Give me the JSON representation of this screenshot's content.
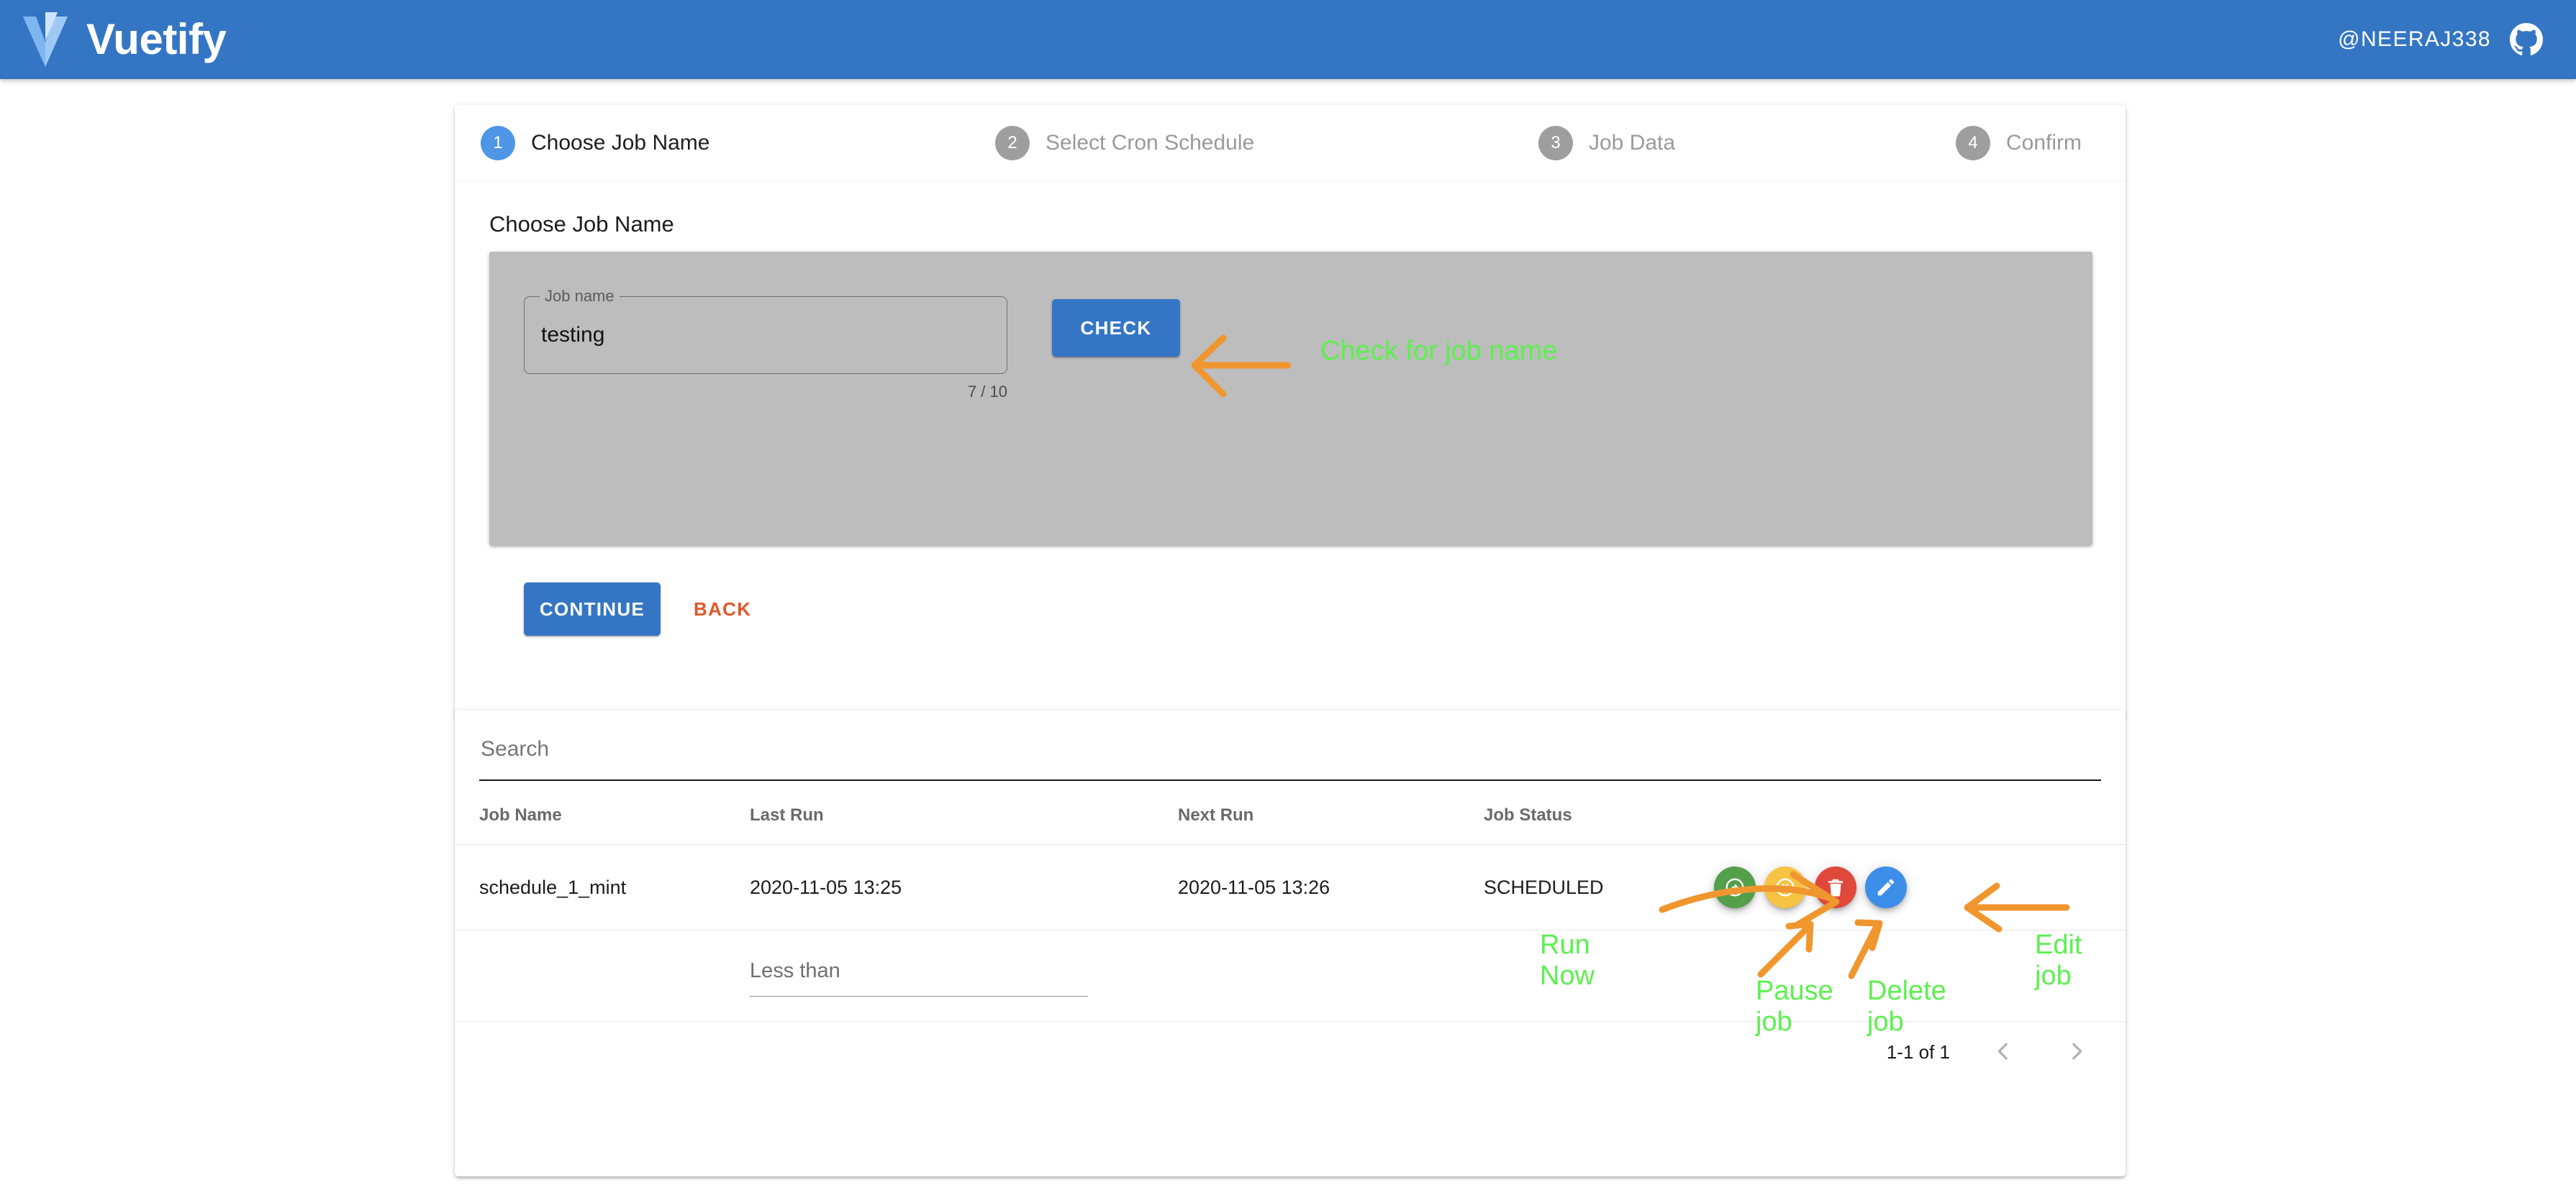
{
  "appbar": {
    "brand": "Vuetify",
    "handle": "@NEERAJ338",
    "github_icon": "github-icon",
    "bg_color": "#3476c4"
  },
  "stepper": {
    "steps": [
      {
        "number": "1",
        "label": "Choose Job Name",
        "active": true
      },
      {
        "number": "2",
        "label": "Select Cron Schedule",
        "active": false
      },
      {
        "number": "3",
        "label": "Job Data",
        "active": false
      },
      {
        "number": "4",
        "label": "Confirm",
        "active": false
      }
    ],
    "content_title": "Choose Job Name",
    "job_name_field": {
      "label": "Job name",
      "value": "testing",
      "placeholder": "",
      "counter": "7 / 10",
      "max_length": 10
    },
    "check_button": "CHECK",
    "continue_button": "CONTINUE",
    "back_button": "BACK"
  },
  "table": {
    "search": {
      "placeholder": "Search",
      "value": ""
    },
    "columns": [
      "Job Name",
      "Last Run",
      "Next Run",
      "Job Status",
      ""
    ],
    "rows": [
      {
        "job_name": "schedule_1_mint",
        "last_run": "2020-11-05 13:25",
        "next_run": "2020-11-05 13:26",
        "status": "SCHEDULED",
        "actions": [
          {
            "name": "run-now-button",
            "icon": "play-circle-icon",
            "color": "#539f4a"
          },
          {
            "name": "pause-job-button",
            "icon": "pause-circle-icon",
            "color": "#f6c344"
          },
          {
            "name": "delete-job-button",
            "icon": "trash-icon",
            "color": "#e0483c"
          },
          {
            "name": "edit-job-button",
            "icon": "pencil-icon",
            "color": "#3d8ee8"
          }
        ]
      }
    ],
    "filter": {
      "label": "Less than",
      "placeholder": "Less than",
      "value": ""
    },
    "pagination": {
      "page_info": "1-1 of 1",
      "prev_icon": "chevron-left-icon",
      "next_icon": "chevron-right-icon"
    }
  },
  "annotations": {
    "color": "#5cf04f",
    "arrow_color": "#f0962f",
    "items": [
      {
        "id": "check",
        "text": "Check for job name"
      },
      {
        "id": "run",
        "text": "Run\nNow"
      },
      {
        "id": "pause",
        "text": "Pause\njob"
      },
      {
        "id": "delete",
        "text": "Delete\njob"
      },
      {
        "id": "edit",
        "text": "Edit\njob"
      }
    ]
  }
}
